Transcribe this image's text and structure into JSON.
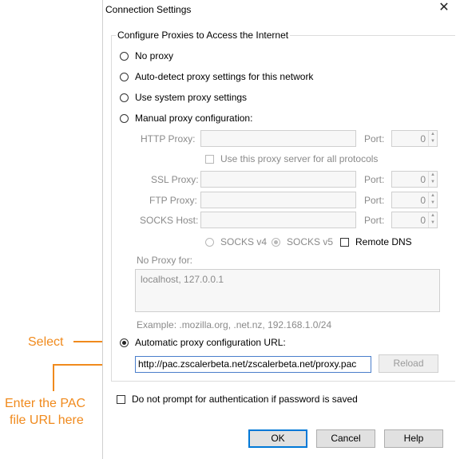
{
  "dialog": {
    "title": "Connection Settings",
    "close_glyph": "✕"
  },
  "group": {
    "legend": "Configure Proxies to Access the Internet"
  },
  "options": {
    "no_proxy": "No proxy",
    "auto_detect": "Auto-detect proxy settings for this network",
    "system": "Use system proxy settings",
    "manual": "Manual proxy configuration:",
    "pac": "Automatic proxy configuration URL:"
  },
  "selected_option": "pac",
  "manual": {
    "http_label": "HTTP Proxy:",
    "ssl_label": "SSL Proxy:",
    "ftp_label": "FTP Proxy:",
    "socks_label": "SOCKS Host:",
    "port_label": "Port:",
    "http_port": "0",
    "ssl_port": "0",
    "ftp_port": "0",
    "socks_port": "0",
    "share_label": "Use this proxy server for all protocols",
    "socks_v4": "SOCKS v4",
    "socks_v5": "SOCKS v5",
    "remote_dns": "Remote DNS"
  },
  "no_proxy": {
    "label": "No Proxy for:",
    "value": "localhost, 127.0.0.1",
    "example": "Example: .mozilla.org, .net.nz, 192.168.1.0/24"
  },
  "pac": {
    "url": "http://pac.zscalerbeta.net/zscalerbeta.net/proxy.pac",
    "reload": "Reload"
  },
  "auth_prompt": "Do not prompt for authentication if password is saved",
  "buttons": {
    "ok": "OK",
    "cancel": "Cancel",
    "help": "Help"
  },
  "annotations": {
    "select": "Select",
    "enter_line1": "Enter the PAC",
    "enter_line2": "file URL here",
    "color": "#f08a1d"
  },
  "colors": {
    "accent": "#0078d7",
    "annotation": "#f08a1d"
  }
}
